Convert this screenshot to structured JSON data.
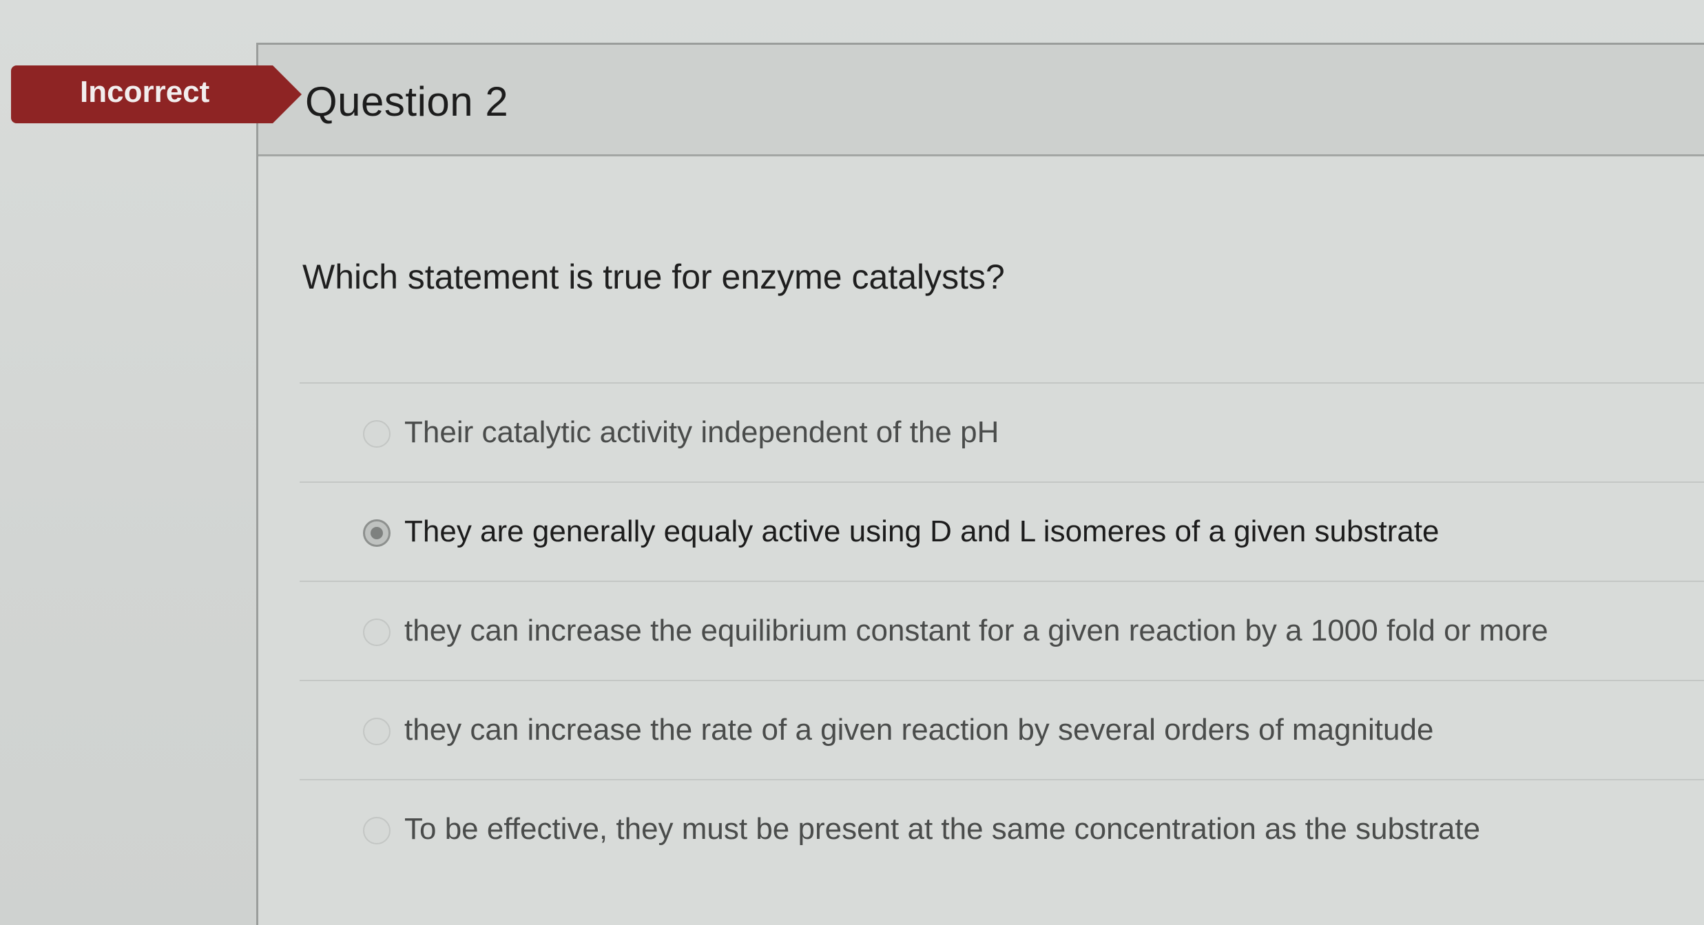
{
  "status": {
    "label": "Incorrect",
    "color": "#8e2424"
  },
  "question": {
    "title": "Question 2",
    "text": "Which statement is true for enzyme catalysts?"
  },
  "options": [
    {
      "label": "Their catalytic activity independent of the pH",
      "selected": false
    },
    {
      "label": "They are generally equaly active using D and L isomeres of a given substrate",
      "selected": true
    },
    {
      "label": "they can increase the equilibrium constant for a given reaction by a 1000 fold or more",
      "selected": false
    },
    {
      "label": "they can increase the rate of a given reaction by several orders of magnitude",
      "selected": false
    },
    {
      "label": "To be effective, they must be present at the same concentration as the substrate",
      "selected": false
    }
  ]
}
